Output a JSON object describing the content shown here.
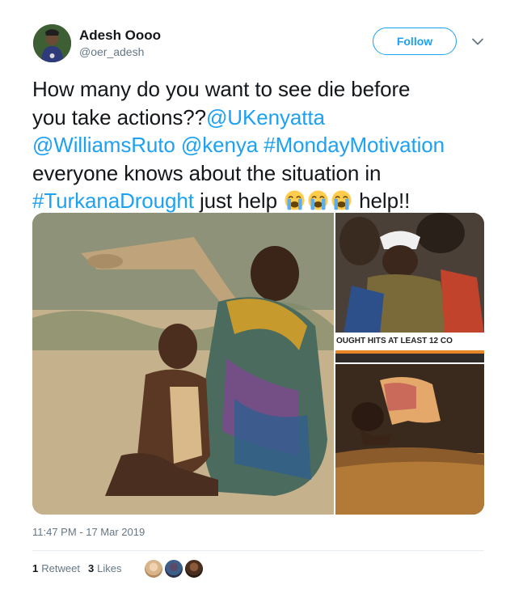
{
  "author": {
    "name": "Adesh Oooo",
    "handle": "@oer_adesh"
  },
  "follow_label": "Follow",
  "tweet": {
    "line1": "How many do you want to see die  before",
    "line2_text": "you take actions??",
    "mention_uhuru": "@UKenyatta",
    "mention_ruto": "@WilliamsRuto",
    "mention_kenya": "@kenya",
    "hashtag_monday": "#MondayMotivation",
    "line4_text": "everyone knows about the situation in",
    "hashtag_turkana": "#TurkanaDrought",
    "just_help": " just help ",
    "help_end": " help!!",
    "emoji_name": "loudly-crying-face-icon",
    "emoji_count": 3
  },
  "media": {
    "banner_text": "OUGHT HITS AT LEAST 12 CO"
  },
  "timestamp": "11:47 PM - 17 Mar 2019",
  "stats": {
    "retweets_count": "1",
    "retweets_label": "Retweet",
    "likes_count": "3",
    "likes_label": "Likes"
  },
  "colors": {
    "link": "#1da1f2",
    "text": "#14171a",
    "muted": "#657786"
  }
}
